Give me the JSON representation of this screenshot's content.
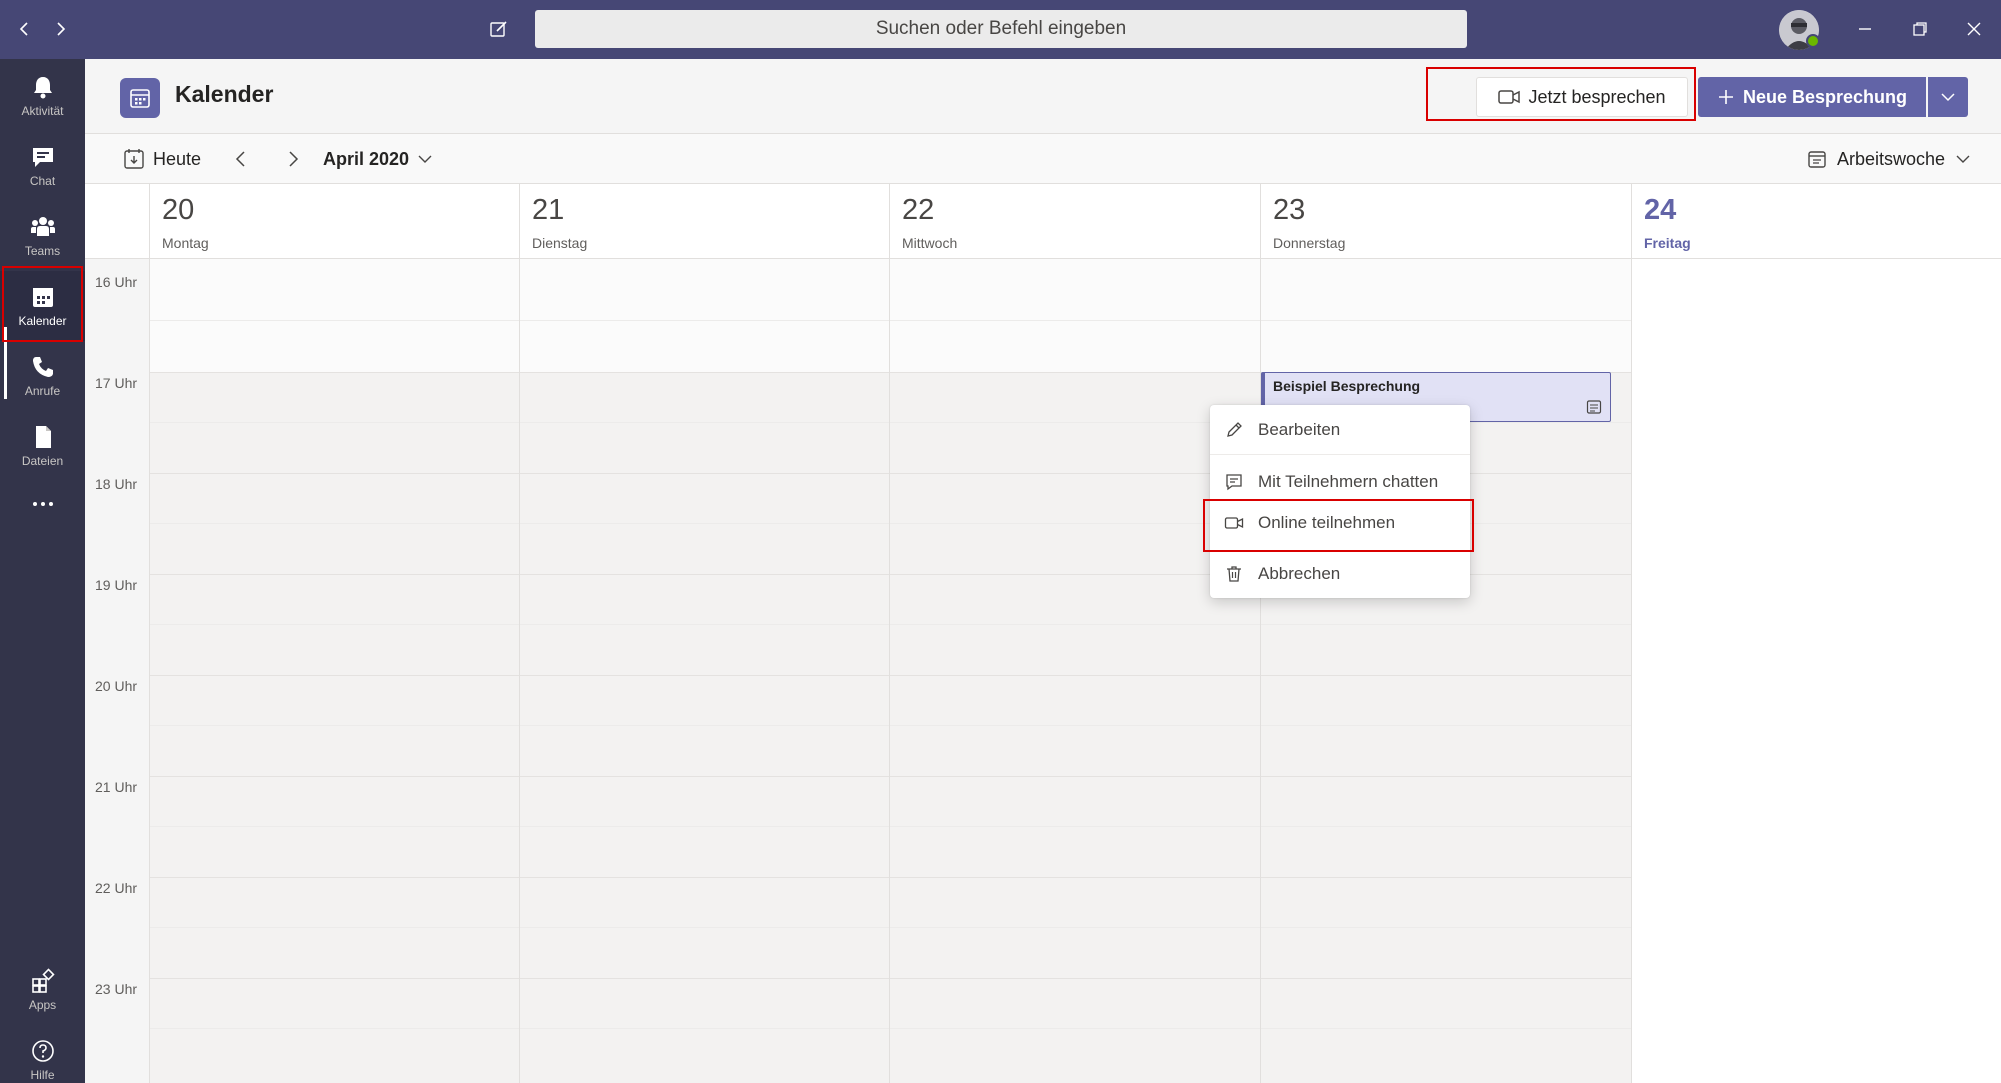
{
  "titlebar": {
    "search_placeholder": "Suchen oder Befehl eingeben"
  },
  "rail": {
    "items": [
      {
        "label": "Aktivität",
        "icon": "bell-icon"
      },
      {
        "label": "Chat",
        "icon": "chat-icon"
      },
      {
        "label": "Teams",
        "icon": "teams-icon"
      },
      {
        "label": "Kalender",
        "icon": "calendar-icon"
      },
      {
        "label": "Anrufe",
        "icon": "phone-icon"
      },
      {
        "label": "Dateien",
        "icon": "file-icon"
      }
    ],
    "apps_label": "Apps",
    "help_label": "Hilfe"
  },
  "header": {
    "title": "Kalender",
    "meet_now_label": "Jetzt besprechen",
    "new_meeting_label": "Neue Besprechung"
  },
  "toolbar": {
    "today_label": "Heute",
    "month_label": "April 2020",
    "view_label": "Arbeitswoche"
  },
  "days": [
    {
      "num": "20",
      "name": "Montag"
    },
    {
      "num": "21",
      "name": "Dienstag"
    },
    {
      "num": "22",
      "name": "Mittwoch"
    },
    {
      "num": "23",
      "name": "Donnerstag"
    },
    {
      "num": "24",
      "name": "Freitag"
    }
  ],
  "hours": [
    "16 Uhr",
    "17 Uhr",
    "18 Uhr",
    "19 Uhr",
    "20 Uhr",
    "21 Uhr",
    "22 Uhr",
    "23 Uhr"
  ],
  "event": {
    "title": "Beispiel Besprechung"
  },
  "context_menu": {
    "items": [
      {
        "label": "Bearbeiten",
        "icon": "pencil-icon"
      },
      {
        "label": "Mit Teilnehmern chatten",
        "icon": "chat-icon"
      },
      {
        "label": "Online teilnehmen",
        "icon": "video-icon"
      },
      {
        "label": "Abbrechen",
        "icon": "trash-icon"
      }
    ]
  },
  "colors": {
    "titlebar": "#464775",
    "rail": "#33344a",
    "accent": "#6264a7",
    "highlight": "#d90000"
  }
}
